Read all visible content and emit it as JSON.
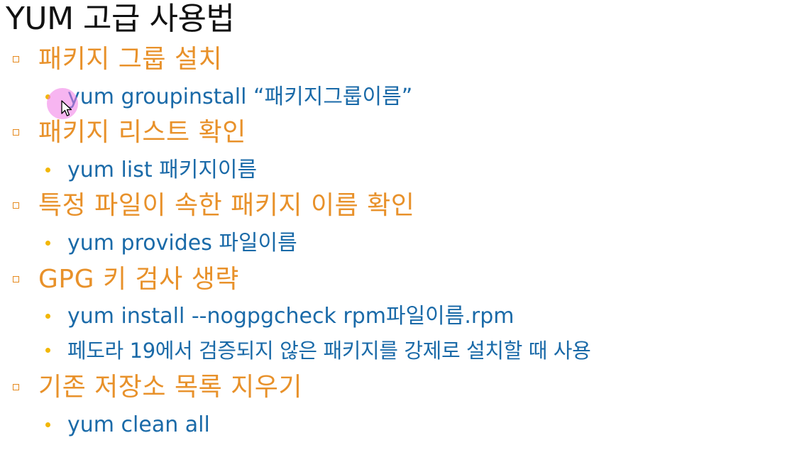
{
  "slide": {
    "title": "YUM 고급 사용법",
    "items": [
      {
        "heading": "패키지 그룹 설치",
        "subitems": [
          "yum groupinstall “패키지그룹이름”"
        ]
      },
      {
        "heading": "패키지 리스트 확인",
        "subitems": [
          "yum list 패키지이름"
        ]
      },
      {
        "heading": "특정 파일이 속한 패키지 이름 확인",
        "subitems": [
          "yum provides 파일이름"
        ]
      },
      {
        "heading": "GPG 키 검사 생략",
        "subitems": [
          "yum install --nogpgcheck rpm파일이름.rpm",
          "페도라 19에서 검증되지 않은 패키지를 강제로 설치할 때 사용"
        ]
      },
      {
        "heading": "기존 저장소 목록 지우기",
        "subitems": [
          "yum clean all"
        ]
      }
    ]
  },
  "colors": {
    "title": "#111111",
    "heading": "#e8912a",
    "subitem": "#1a6aa8",
    "subbullet": "#f2b705",
    "cursor_halo": "#f078e6"
  },
  "cursor": {
    "icon": "mouse-pointer-icon"
  }
}
